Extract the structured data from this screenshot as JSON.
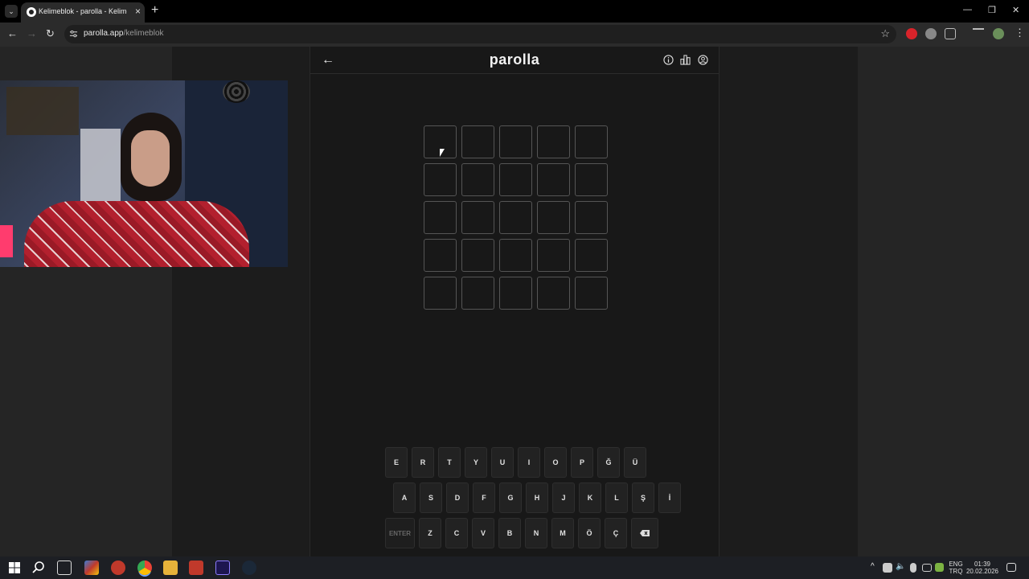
{
  "browser": {
    "tab_title": "Kelimeblok - parolla - Kelime o",
    "url_host": "parolla.app",
    "url_path": "/kelimeblok"
  },
  "app": {
    "logo": "parolla",
    "grid": {
      "rows": 5,
      "cols": 5
    }
  },
  "keyboard": {
    "row1": [
      "E",
      "R",
      "T",
      "Y",
      "U",
      "I",
      "O",
      "P",
      "Ğ",
      "Ü"
    ],
    "row2": [
      "A",
      "S",
      "D",
      "F",
      "G",
      "H",
      "J",
      "K",
      "L",
      "Ş",
      "İ"
    ],
    "row3": [
      "Z",
      "C",
      "V",
      "B",
      "N",
      "M",
      "Ö",
      "Ç"
    ],
    "enter_label": "ENTER"
  },
  "taskbar": {
    "lang_line1": "ENG",
    "lang_line2": "TRQ",
    "time": "01:39",
    "date": "20.02.2026"
  },
  "colors": {
    "background": "#181818",
    "tile_border": "#555555",
    "key_bg": "#222222"
  }
}
